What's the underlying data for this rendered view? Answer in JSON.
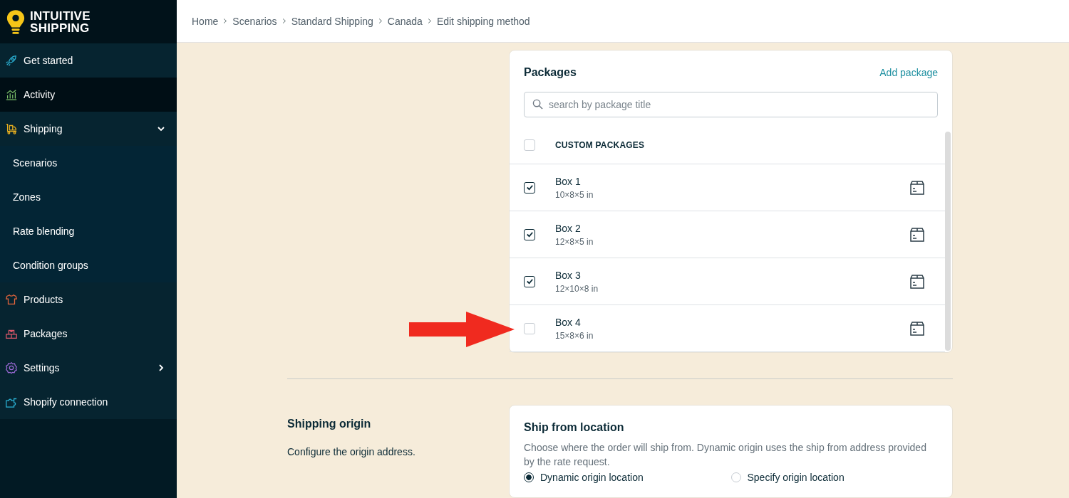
{
  "logo": {
    "line1": "INTUITIVE",
    "line2": "SHIPPING"
  },
  "sidebar": {
    "items": [
      {
        "label": "Get started",
        "kind": "main",
        "selected": false
      },
      {
        "label": "Activity",
        "kind": "main",
        "selected": true
      },
      {
        "label": "Shipping",
        "kind": "main",
        "selected": false,
        "expanded": true,
        "children": [
          {
            "label": "Scenarios",
            "kind": "sub",
            "selected": false
          },
          {
            "label": "Zones",
            "kind": "sub",
            "selected": false
          },
          {
            "label": "Rate blending",
            "kind": "sub",
            "selected": false
          },
          {
            "label": "Condition groups",
            "kind": "sub",
            "selected": false
          }
        ]
      },
      {
        "label": "Products",
        "kind": "main",
        "selected": false
      },
      {
        "label": "Packages",
        "kind": "main",
        "selected": false
      },
      {
        "label": "Settings",
        "kind": "main",
        "selected": false,
        "expanded": false
      },
      {
        "label": "Shopify connection",
        "kind": "main",
        "selected": false
      }
    ]
  },
  "breadcrumb": [
    "Home",
    "Scenarios",
    "Standard Shipping",
    "Canada",
    "Edit shipping method"
  ],
  "packages": {
    "title": "Packages",
    "add_link": "Add package",
    "search": {
      "placeholder": "search by package title"
    },
    "header": {
      "label": "CUSTOM PACKAGES",
      "checked": false
    },
    "rows": [
      {
        "name": "Box 1",
        "size": "10×8×5 in",
        "checked": true
      },
      {
        "name": "Box 2",
        "size": "12×8×5 in",
        "checked": true
      },
      {
        "name": "Box 3",
        "size": "12×10×8 in",
        "checked": true
      },
      {
        "name": "Box 4",
        "size": "15×8×6 in",
        "checked": false
      }
    ]
  },
  "shipping_origin": {
    "title": "Shipping origin",
    "description": "Configure the origin address.",
    "card": {
      "title": "Ship from location",
      "text": "Choose where the order will ship from. Dynamic origin uses the ship from address provided by the rate request.",
      "options": [
        {
          "label": "Dynamic origin location",
          "selected": true
        },
        {
          "label": "Specify origin location",
          "selected": false
        }
      ]
    }
  }
}
